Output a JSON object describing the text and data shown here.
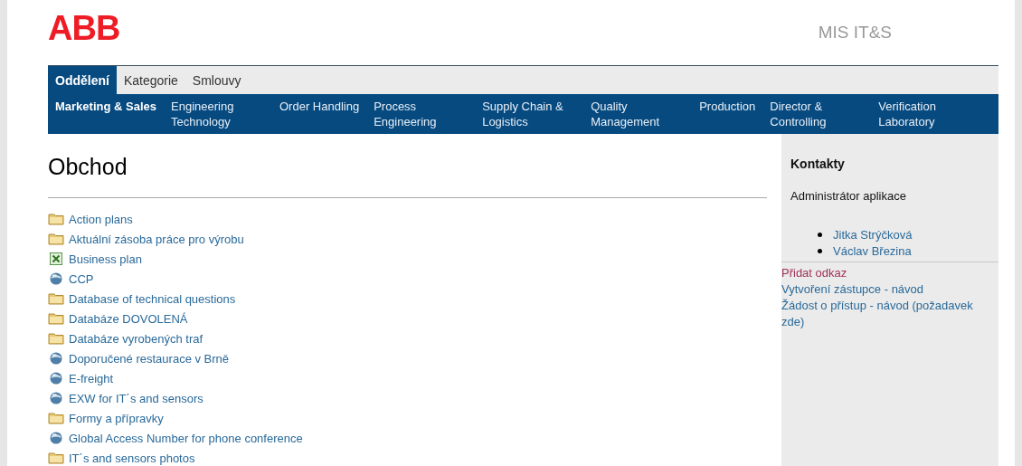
{
  "header": {
    "logo": "ABB",
    "app_title": "MIS IT&S"
  },
  "tabs": [
    {
      "label": "Oddělení",
      "selected": true
    },
    {
      "label": "Kategorie",
      "selected": false
    },
    {
      "label": "Smlouvy",
      "selected": false
    }
  ],
  "departments": [
    {
      "label": "Marketing & Sales",
      "selected": true
    },
    {
      "label": "Engineering Technology",
      "selected": false
    },
    {
      "label": "Order Handling",
      "selected": false
    },
    {
      "label": "Process Engineering",
      "selected": false
    },
    {
      "label": "Supply Chain & Logistics",
      "selected": false
    },
    {
      "label": "Quality Management",
      "selected": false
    },
    {
      "label": "Production",
      "selected": false
    },
    {
      "label": "Director & Controlling",
      "selected": false
    },
    {
      "label": "Verification Laboratory",
      "selected": false
    }
  ],
  "page_title": "Obchod",
  "links": [
    {
      "kind": "folder",
      "label": "Action plans"
    },
    {
      "kind": "folder",
      "label": "Aktuální zásoba práce pro výrobu"
    },
    {
      "kind": "excel",
      "label": "Business plan"
    },
    {
      "kind": "globe",
      "label": "CCP"
    },
    {
      "kind": "folder",
      "label": "Database of technical questions"
    },
    {
      "kind": "folder",
      "label": "Databáze DOVOLENÁ"
    },
    {
      "kind": "folder",
      "label": "Databáze vyrobených traf"
    },
    {
      "kind": "globe",
      "label": "Doporučené restaurace v Brně"
    },
    {
      "kind": "globe",
      "label": "E-freight"
    },
    {
      "kind": "globe",
      "label": "EXW for IT´s and sensors"
    },
    {
      "kind": "folder",
      "label": "Formy a přípravky"
    },
    {
      "kind": "globe",
      "label": "Global Access Number for phone conference"
    },
    {
      "kind": "folder",
      "label": "IT´s and sensors photos"
    }
  ],
  "sidebar": {
    "heading": "Kontakty",
    "subheading": "Administrátor aplikace",
    "contacts": [
      "Jitka Strýčková",
      "Václav Březina"
    ],
    "add_link": "Přidat odkaz",
    "help_links": [
      "Vytvoření zástupce - návod",
      "Žádost o přístup - návod (požadavek zde)"
    ]
  }
}
